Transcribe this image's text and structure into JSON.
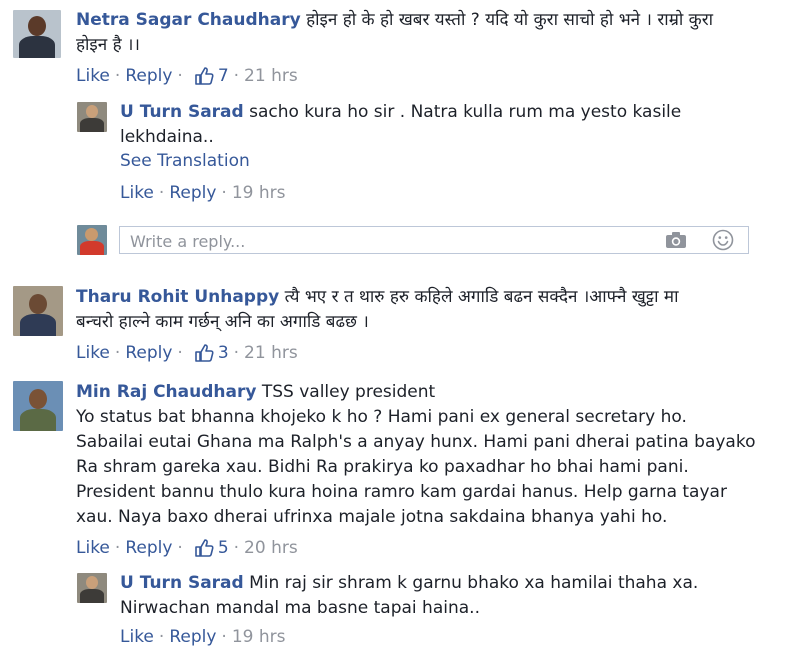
{
  "comments": [
    {
      "author": "Netra Sagar Chaudhary",
      "line1": "होइन हो के हो खबर यस्तो ? यदि यो कुरा साचो हो भने । राम्रो कुरा",
      "line2": "होइन है ।।",
      "like_label": "Like",
      "reply_label": "Reply",
      "likes": "7",
      "time": "21 hrs",
      "reply": {
        "author": "U Turn Sarad",
        "line1": "sacho kura ho sir . Natra kulla rum ma yesto kasile",
        "line2": "lekhdaina..",
        "see_translation": "See Translation",
        "like_label": "Like",
        "reply_label": "Reply",
        "time": "19 hrs"
      }
    },
    {
      "author": "Tharu Rohit Unhappy",
      "line1": "त्यै भए र त थारु हरु कहिले अगाडि बढन सक्दैन ।आफ्नै खुट्टा मा",
      "line2": "बन्चरो हाल्ने काम गर्छन् अनि का अगाडि बढछ ।",
      "like_label": "Like",
      "reply_label": "Reply",
      "likes": "3",
      "time": "21 hrs"
    },
    {
      "author": "Min Raj Chaudhary",
      "line1": "TSS valley president",
      "body": [
        "Yo status bat bhanna khojeko k ho ? Hami pani ex general secretary ho.",
        "Sabailai eutai Ghana ma Ralph's a anyay hunx. Hami pani dherai patina bayako",
        "Ra shram gareka xau. Bidhi Ra prakirya ko paxadhar ho bhai hami pani.",
        "President bannu thulo kura hoina ramro kam gardai hanus. Help garna tayar",
        "xau. Naya baxo dherai ufrinxa majale jotna sakdaina bhanya yahi ho."
      ],
      "like_label": "Like",
      "reply_label": "Reply",
      "likes": "5",
      "time": "20 hrs",
      "reply": {
        "author": "U Turn Sarad",
        "line1": "Min raj sir shram k garnu bhako xa hamilai thaha xa.",
        "line2": "Nirwachan mandal ma basne tapai haina..",
        "like_label": "Like",
        "reply_label": "Reply",
        "time": "19 hrs"
      }
    }
  ],
  "reply_box": {
    "placeholder": "Write a reply...",
    "camera_icon": "camera-icon",
    "emoji_icon": "smiley-icon"
  },
  "colors": {
    "link": "#365899",
    "meta": "#90949c",
    "text": "#1d2129",
    "border": "#bdc7d8"
  }
}
